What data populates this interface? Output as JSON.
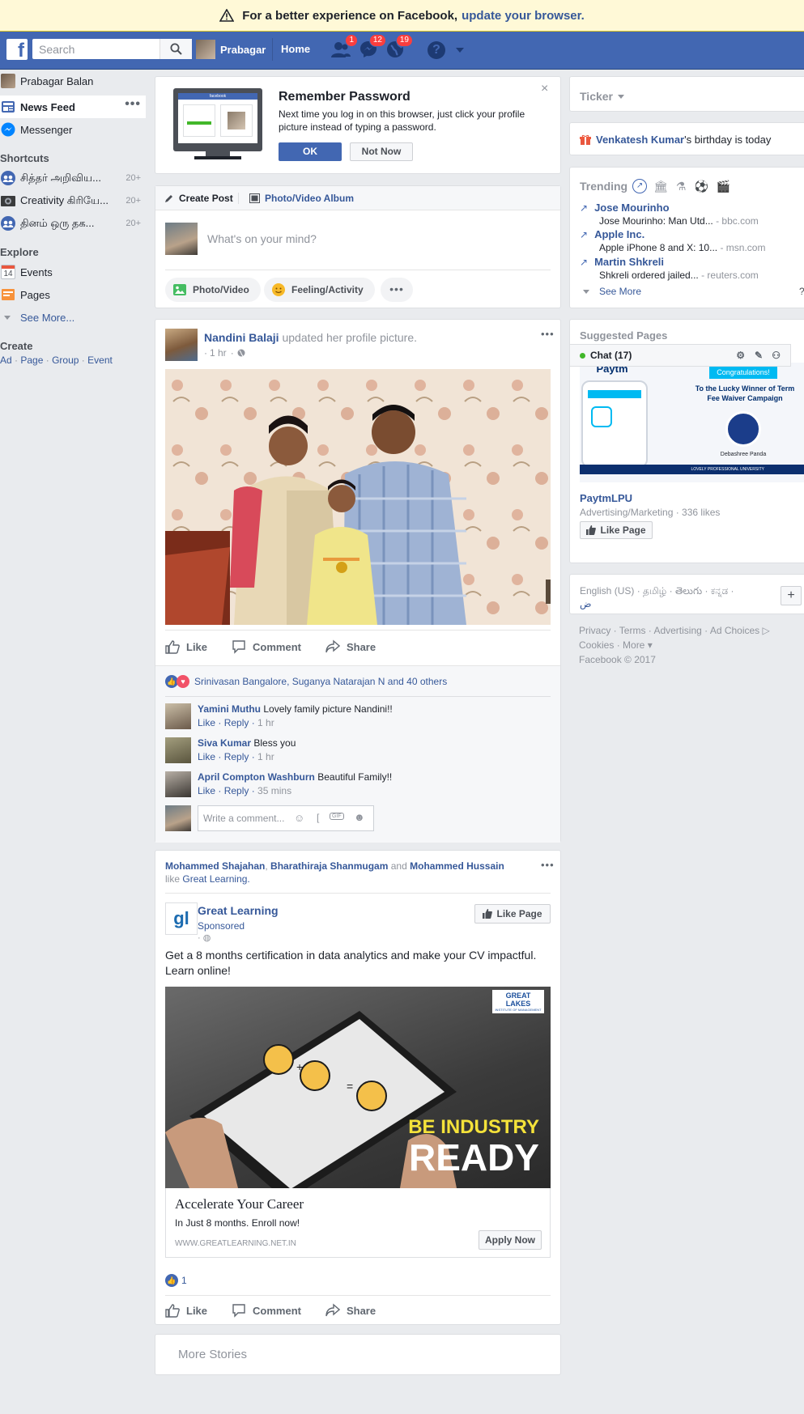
{
  "banner": {
    "text": "For a better experience on Facebook,",
    "link": "update your browser."
  },
  "topbar": {
    "search_placeholder": "Search",
    "profile_name": "Prabagar",
    "home_label": "Home",
    "friend_requests_count": "1",
    "messages_count": "12",
    "notifications_count": "19"
  },
  "leftnav": {
    "profile": "Prabagar Balan",
    "news_feed": "News Feed",
    "messenger": "Messenger",
    "shortcuts_heading": "Shortcuts",
    "shortcuts": [
      {
        "label": "சித்தர் அறிவிய...",
        "count": "20+"
      },
      {
        "label": "Creativity கிரியே...",
        "count": "20+"
      },
      {
        "label": "தினம் ஒரு தக...",
        "count": "20+"
      }
    ],
    "explore_heading": "Explore",
    "events": "Events",
    "events_date": "14",
    "pages": "Pages",
    "see_more": "See More...",
    "create_heading": "Create",
    "create_links": [
      "Ad",
      "Page",
      "Group",
      "Event"
    ]
  },
  "remember": {
    "title": "Remember Password",
    "body": "Next time you log in on this browser, just click your profile picture instead of typing a password.",
    "ok": "OK",
    "not_now": "Not Now",
    "monitor_brand": "facebook"
  },
  "composer": {
    "create_post": "Create Post",
    "album": "Photo/Video Album",
    "placeholder": "What's on your mind?",
    "photo_video": "Photo/Video",
    "feeling": "Feeling/Activity"
  },
  "post1": {
    "author": "Nandini Balaji",
    "action": "updated her profile picture.",
    "time": "1 hr",
    "like": "Like",
    "comment": "Comment",
    "share": "Share",
    "reactions_text": "Srinivasan Bangalore, Suganya Natarajan N and 40 others",
    "comments": [
      {
        "name": "Yamini Muthu",
        "text": "Lovely family picture Nandini!!",
        "like": "Like",
        "reply": "Reply",
        "time": "1 hr"
      },
      {
        "name": "Siva Kumar",
        "text": "Bless you",
        "like": "Like",
        "reply": "Reply",
        "time": "1 hr"
      },
      {
        "name": "April Compton Washburn",
        "text": "Beautiful Family!!",
        "like": "Like",
        "reply": "Reply",
        "time": "35 mins"
      }
    ],
    "write_comment": "Write a comment..."
  },
  "post2": {
    "friend1": "Mohammed Shajahan",
    "friend2": "Bharathiraja Shanmugam",
    "and": "and",
    "friend3": "Mohammed Hussain",
    "like_word": "like",
    "page_liked": "Great Learning.",
    "page_name": "Great Learning",
    "sponsored": "Sponsored",
    "like_page": "Like Page",
    "text": "Get a 8 months certification in data analytics and make your CV impactful. Learn online!",
    "ad_brand": "GREAT LAKES",
    "ad_brand_sub": "INSTITUTE OF MANAGEMENT",
    "ad_line1": "BE INDUSTRY",
    "ad_line2": "READY",
    "link_title": "Accelerate Your Career",
    "link_desc": "In Just 8 months. Enroll now!",
    "link_domain": "WWW.GREATLEARNING.NET.IN",
    "apply": "Apply Now",
    "like_count": "1",
    "like": "Like",
    "comment": "Comment",
    "share": "Share"
  },
  "more_stories": "More Stories",
  "right": {
    "ticker": "Ticker",
    "birthday_name": "Venkatesh Kumar",
    "birthday_text": "'s birthday is today",
    "trending_heading": "Trending",
    "trends": [
      {
        "name": "Jose Mourinho",
        "desc": "Jose Mourinho: Man Utd...",
        "source": "bbc.com"
      },
      {
        "name": "Apple Inc.",
        "desc": "Apple iPhone 8 and X: 10...",
        "source": "msn.com"
      },
      {
        "name": "Martin Shkreli",
        "desc": "Shkreli ordered jailed...",
        "source": "reuters.com"
      }
    ],
    "trending_see_more": "See More",
    "suggested_heading": "Suggested Pages",
    "chat_label": "Chat (17)",
    "ad_brand": "Paytm",
    "ad_congrats": "Congratulations!",
    "ad_line": "To the Lucky Winner of Term Fee Waiver Campaign",
    "ad_person": "Debashree Panda",
    "ad_uni": "LOVELY PROFESSIONAL UNIVERSITY",
    "sugg_page": "PaytmLPU",
    "sugg_meta": "Advertising/Marketing · 336 likes",
    "sugg_like": "Like Page",
    "languages": "English (US) · தமிழ் · తెలుగు · ಕನ್ನಡ ·",
    "lang_extra": "ض",
    "footer1": "Privacy · Terms · Advertising · Ad Choices",
    "footer2": "Cookies · More ▾",
    "footer3": "Facebook © 2017"
  },
  "colors": {
    "brand_blue": "#4267b2",
    "link_blue": "#365899",
    "badge_red": "#fa3e3e",
    "banner_bg": "#fff9d7"
  }
}
